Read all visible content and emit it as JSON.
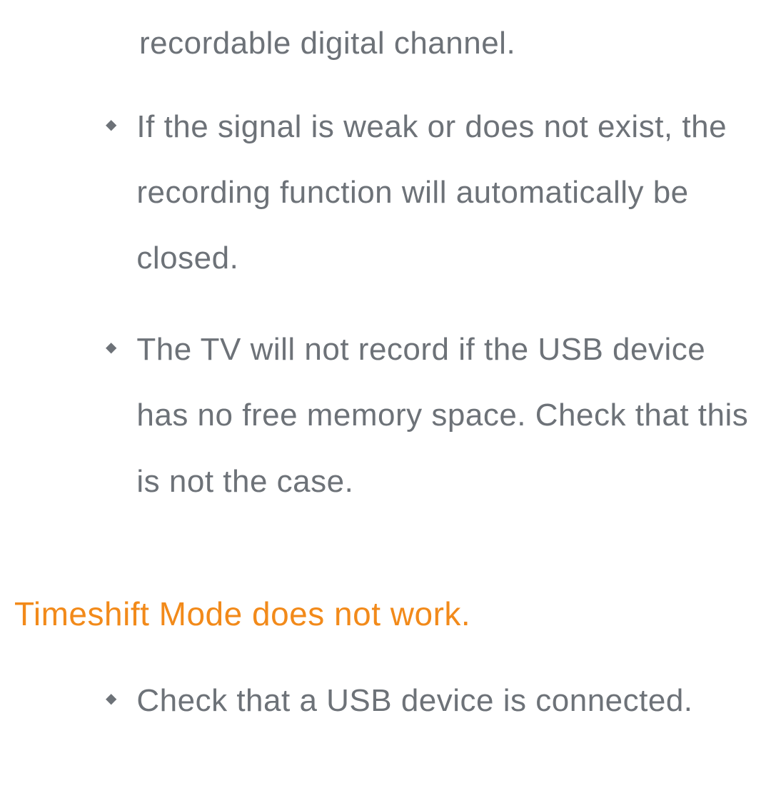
{
  "fragment": "recordable digital channel.",
  "bullets_first": [
    "If the signal is weak or does not exist, the recording function will automatically be closed.",
    "The TV will not record if the USB device has no free memory space. Check that this is not the case."
  ],
  "heading": "Timeshift Mode does not work.",
  "bullets_second": [
    "Check that a USB device is connected."
  ]
}
